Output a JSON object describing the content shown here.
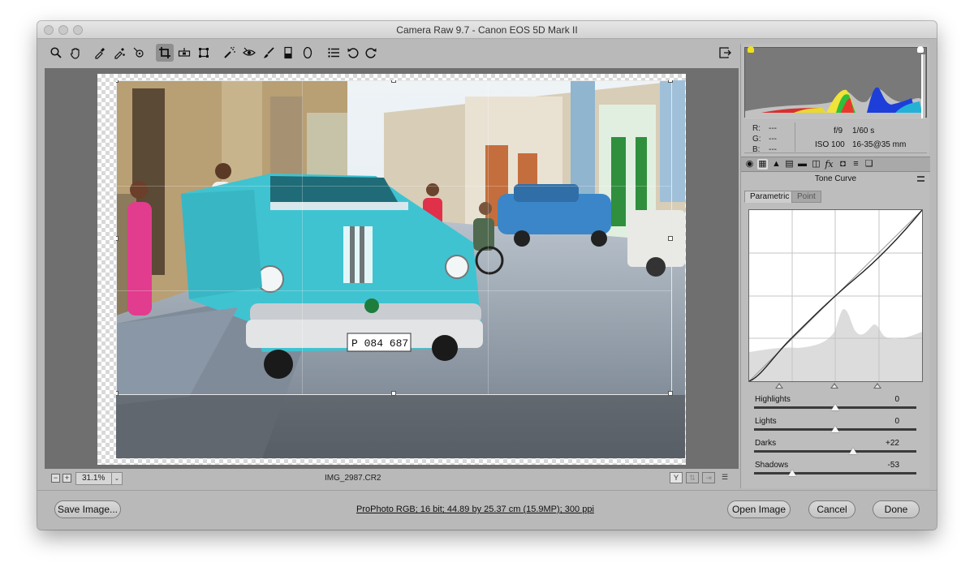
{
  "window": {
    "title": "Camera Raw 9.7  -  Canon EOS 5D Mark II"
  },
  "toolbar": {
    "tools": [
      {
        "name": "zoom-tool",
        "icon": "magnifier-icon"
      },
      {
        "name": "hand-tool",
        "icon": "hand-icon"
      },
      {
        "name": "white-balance-tool",
        "icon": "eyedropper-icon"
      },
      {
        "name": "color-sampler-tool",
        "icon": "color-sampler-icon"
      },
      {
        "name": "targeted-adjustment-tool",
        "icon": "targeted-adjustment-icon"
      },
      {
        "name": "crop-tool",
        "icon": "crop-icon",
        "active": true
      },
      {
        "name": "straighten-tool",
        "icon": "level-icon"
      },
      {
        "name": "transform-tool",
        "icon": "transform-icon"
      },
      {
        "name": "spot-removal-tool",
        "icon": "spot-removal-icon"
      },
      {
        "name": "red-eye-tool",
        "icon": "eye-icon"
      },
      {
        "name": "adjustment-brush-tool",
        "icon": "brush-icon"
      },
      {
        "name": "graduated-filter-tool",
        "icon": "graduated-filter-icon"
      },
      {
        "name": "radial-filter-tool",
        "icon": "ellipse-icon"
      },
      {
        "name": "open-preferences-tool",
        "icon": "list-icon"
      },
      {
        "name": "rotate-left-tool",
        "icon": "rotate-ccw-icon"
      },
      {
        "name": "rotate-right-tool",
        "icon": "rotate-cw-icon"
      }
    ],
    "fullscreen_icon": "fullscreen-icon"
  },
  "status": {
    "zoom": "31.1%",
    "filename": "IMG_2987.CR2",
    "view_button": "Y"
  },
  "readout": {
    "r_label": "R:",
    "r_value": "---",
    "g_label": "G:",
    "g_value": "---",
    "b_label": "B:",
    "b_value": "---",
    "aperture": "f/9",
    "shutter": "1/60 s",
    "iso": "ISO 100",
    "lens": "16-35@35 mm"
  },
  "panel": {
    "section_title": "Tone Curve",
    "subtabs": [
      "Parametric",
      "Point"
    ],
    "sliders": [
      {
        "label": "Highlights",
        "value": "0",
        "position": 0.5
      },
      {
        "label": "Lights",
        "value": "0",
        "position": 0.5
      },
      {
        "label": "Darks",
        "value": "+22",
        "position": 0.61
      },
      {
        "label": "Shadows",
        "value": "-53",
        "position": 0.235
      }
    ]
  },
  "bottom": {
    "save_label": "Save Image...",
    "workflow_info": "ProPhoto RGB; 16 bit; 44.89 by 25.37 cm (15.9MP); 300 ppi",
    "open_label": "Open Image",
    "cancel_label": "Cancel",
    "done_label": "Done"
  },
  "colors": {
    "car_turquoise": "#3fc3d1",
    "histogram_bg": "#797979",
    "panel_bg": "#bdbdbd"
  }
}
